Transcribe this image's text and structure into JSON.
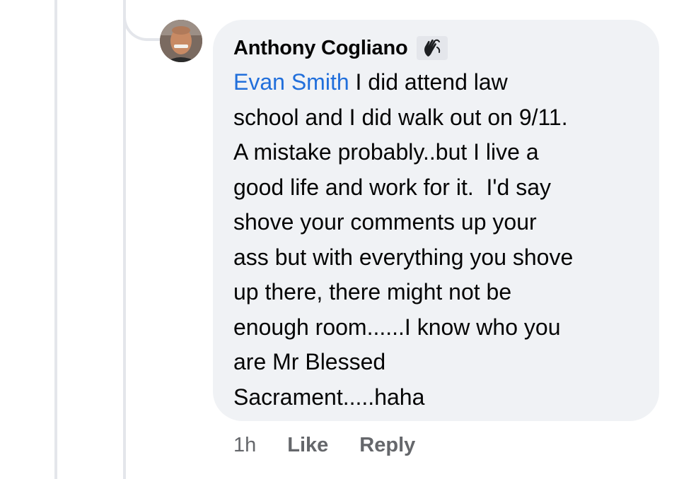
{
  "comment": {
    "author": "Anthony Cogliano",
    "author_badge_icon": "waving-hand-icon",
    "mention": "Evan Smith",
    "text_lines": [
      " I did attend law",
      "school and I did walk out on 9/11.",
      "A mistake probably..but I live a",
      "good life and work for it.  I'd say",
      "shove your comments up your",
      "ass but with everything you shove",
      "up there, there might not be",
      "enough room......I know who you",
      "are Mr Blessed",
      "Sacrament.....haha"
    ],
    "timestamp": "1h",
    "like_label": "Like",
    "reply_label": "Reply"
  },
  "colors": {
    "bubble_background": "#f0f2f5",
    "mention_link": "#216fdb",
    "meta_text": "#65676b",
    "thread_line": "#e4e6eb"
  }
}
